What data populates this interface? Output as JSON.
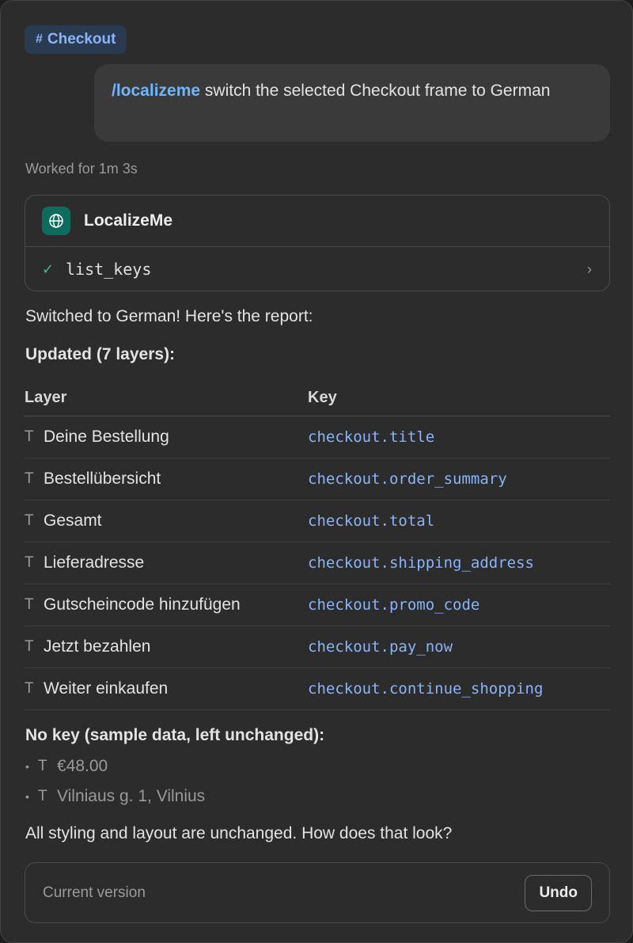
{
  "channel": {
    "hash": "#",
    "name": "Checkout"
  },
  "message": {
    "command": "/localizeme",
    "text": "switch the selected Checkout frame to German"
  },
  "status": {
    "worked": "Worked for 1m 3s"
  },
  "tool": {
    "name": "LocalizeMe",
    "logo_icon": "globe-icon",
    "call": {
      "check": "✓",
      "function": "list_keys",
      "chevron": "›"
    }
  },
  "response": {
    "intro": "Switched to German! Here's the report:",
    "updated_heading": "Updated (7 layers):",
    "table": {
      "headers": {
        "layer": "Layer",
        "key": "Key"
      },
      "rows": [
        {
          "icon": "T",
          "layer": "Deine Bestellung",
          "key": "checkout.title"
        },
        {
          "icon": "T",
          "layer": "Bestellübersicht",
          "key": "checkout.order_summary"
        },
        {
          "icon": "T",
          "layer": "Gesamt",
          "key": "checkout.total"
        },
        {
          "icon": "T",
          "layer": "Lieferadresse",
          "key": "checkout.shipping_address"
        },
        {
          "icon": "T",
          "layer": "Gutscheincode hinzufügen",
          "key": "checkout.promo_code"
        },
        {
          "icon": "T",
          "layer": "Jetzt bezahlen",
          "key": "checkout.pay_now"
        },
        {
          "icon": "T",
          "layer": "Weiter einkaufen",
          "key": "checkout.continue_shopping"
        }
      ]
    },
    "nokey_heading": "No key (sample data, left unchanged):",
    "nokey_items": [
      {
        "bullet": "•",
        "icon": "T",
        "text": "€48.00"
      },
      {
        "bullet": "•",
        "icon": "T",
        "text": "Vilniaus g. 1, Vilnius"
      }
    ],
    "closing": "All styling and layout are unchanged. How does that look?"
  },
  "footer": {
    "label": "Current version",
    "undo_label": "Undo"
  },
  "colors": {
    "accent": "#8ab4f8",
    "command": "#6fb6ff",
    "success": "#35c28a",
    "logo_bg": "#0e6b5e"
  }
}
